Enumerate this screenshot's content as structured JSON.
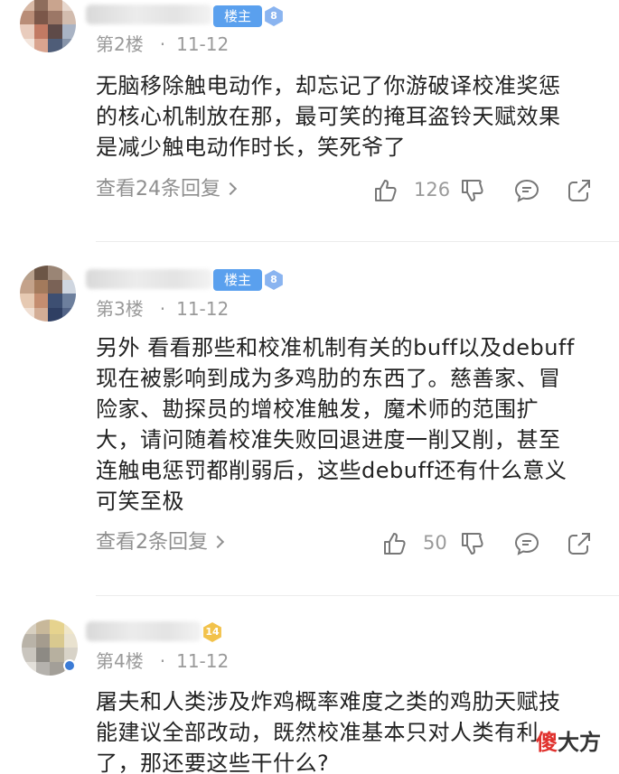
{
  "posts": [
    {
      "host_tag": "楼主",
      "level": "8",
      "floor": "第2楼",
      "date": "11-12",
      "lines": [
        "无脑移除触电动作，却忘记了你游破译校准奖惩",
        "的核心机制放在那，最可笑的掩耳盗铃天赋效果",
        "是减少触电动作时长，笑死爷了"
      ],
      "replies": "查看24条回复",
      "likes": "126"
    },
    {
      "host_tag": "楼主",
      "level": "8",
      "floor": "第3楼",
      "date": "11-12",
      "lines": [
        "另外 看看那些和校准机制有关的buff以及debuff",
        "现在被影响到成为多鸡肋的东西了。慈善家、冒",
        "险家、勘探员的增校准触发，魔术师的范围扩",
        "大，请问随着校准失败回退进度一削又削，甚至",
        "连触电惩罚都削弱后，这些debuff还有什么意义",
        "可笑至极"
      ],
      "replies": "查看2条回复",
      "likes": "50"
    },
    {
      "level": "14",
      "floor": "第4楼",
      "date": "11-12",
      "lines": [
        "屠夫和人类涉及炸鸡概率难度之类的鸡肋天赋技",
        "能建议全部改动，既然校准基本只对人类有利",
        "了，那还要这些干什么?"
      ]
    }
  ],
  "watermark": {
    "part1": "傻",
    "part2": "大方"
  },
  "colors": {
    "host_tag": "#5aa0ee",
    "level_blue": "#8ab4f0",
    "level_gold": "#f2c24b",
    "meta": "#9a9a9a",
    "watermark_red": "#e0312d"
  }
}
